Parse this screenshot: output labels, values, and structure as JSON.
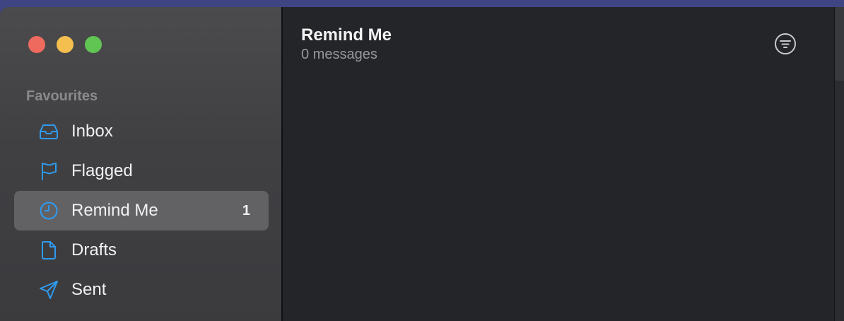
{
  "sidebar": {
    "section_label": "Favourites",
    "items": [
      {
        "label": "Inbox",
        "icon": "inbox-icon",
        "selected": false,
        "badge": ""
      },
      {
        "label": "Flagged",
        "icon": "flag-icon",
        "selected": false,
        "badge": ""
      },
      {
        "label": "Remind Me",
        "icon": "clock-icon",
        "selected": true,
        "badge": "1"
      },
      {
        "label": "Drafts",
        "icon": "document-icon",
        "selected": false,
        "badge": ""
      },
      {
        "label": "Sent",
        "icon": "paper-plane-icon",
        "selected": false,
        "badge": ""
      }
    ]
  },
  "content": {
    "title": "Remind Me",
    "subtitle": "0 messages"
  },
  "colors": {
    "accent": "#2f9bf0",
    "close": "#ee6a5f",
    "minimize": "#f4bf4f",
    "zoom": "#61c554"
  }
}
